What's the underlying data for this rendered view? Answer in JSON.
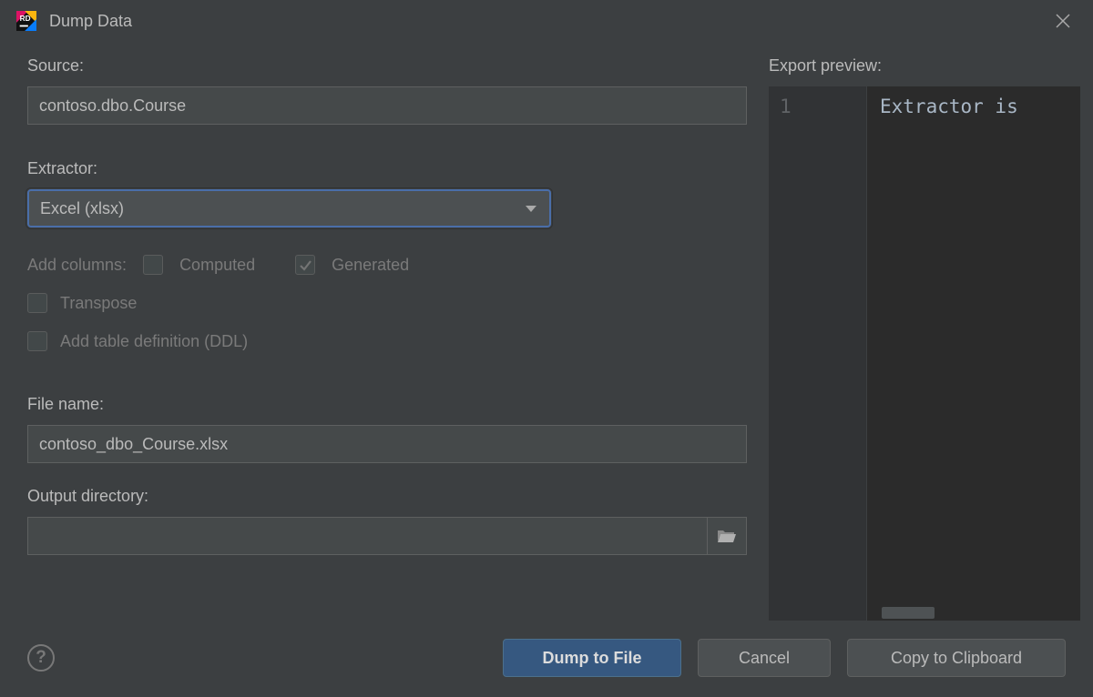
{
  "dialog": {
    "title": "Dump Data"
  },
  "form": {
    "source_label": "Source:",
    "source_value": "contoso.dbo.Course",
    "extractor_label": "Extractor:",
    "extractor_value": "Excel (xlsx)",
    "add_columns_label": "Add columns:",
    "computed_label": "Computed",
    "generated_label": "Generated",
    "transpose_label": "Transpose",
    "ddl_label": "Add table definition (DDL)",
    "filename_label": "File name:",
    "filename_value": "contoso_dbo_Course.xlsx",
    "outdir_label": "Output directory:",
    "outdir_value": ""
  },
  "preview": {
    "label": "Export preview:",
    "line_number": "1",
    "line_text": "Extractor is"
  },
  "buttons": {
    "primary": "Dump to File",
    "cancel": "Cancel",
    "copy": "Copy to Clipboard"
  }
}
